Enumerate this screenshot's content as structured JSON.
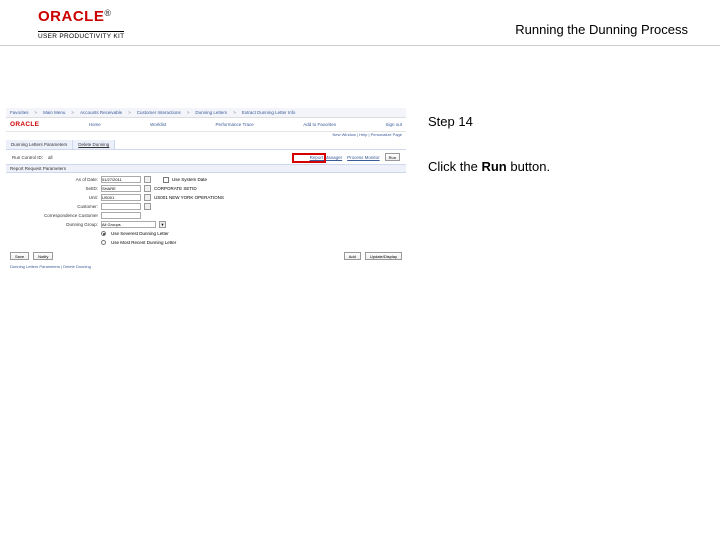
{
  "header": {
    "brand": "ORACLE",
    "subbrand": "USER PRODUCTIVITY KIT",
    "title": "Running the Dunning Process"
  },
  "instruction": {
    "step_label": "Step 14",
    "text_prefix": "Click the ",
    "text_bold": "Run",
    "text_suffix": " button."
  },
  "app": {
    "nav": {
      "items": [
        "Favorites",
        "Main Menu",
        "Accounts Receivable",
        "Customer Interactions",
        "Dunning Letters",
        "Extract Dunning Letter Info"
      ],
      "tools": [
        "Home",
        "Worklist",
        "Performance Trace",
        "Add to Favorites",
        "Sign out"
      ]
    },
    "brand": "ORACLE",
    "subnav": "New Window | Help | Personalize Page",
    "tabs": [
      "Dunning Letters Parameters",
      "Delete Dunning"
    ],
    "run_row": {
      "run_control_label": "Run Control ID:",
      "run_control_value": "all",
      "report_manager": "Report Manager",
      "process_monitor": "Process Monitor",
      "run_button": "Run"
    },
    "section1": "Report Request Parameters",
    "fields": {
      "as_of_date_label": "As of Date:",
      "as_of_date_value": "01/27/2011",
      "use_system_date": "Use System Date",
      "setid_label": "SetID:",
      "setid_value": "SHARE",
      "setid_name": "CORPORATE SETID",
      "unit_label": "Unit:",
      "unit_value": "US001",
      "unit_name": "US001 NEW YORK OPERATIONS",
      "customer_label": "Customer:",
      "corr_cust_label": "Correspondence Customer",
      "dunning_group_label": "Dunning Group:",
      "dunning_group_value": "All Groups",
      "radio1": "Use Severest Dunning Letter",
      "radio2": "Use Most Recent Dunning Letter"
    },
    "buttons": {
      "save": "Save",
      "notify": "Notify",
      "add": "Add",
      "update": "Update/Display"
    },
    "footer_links": "Dunning Letters Parameters | Delete Dunning"
  }
}
